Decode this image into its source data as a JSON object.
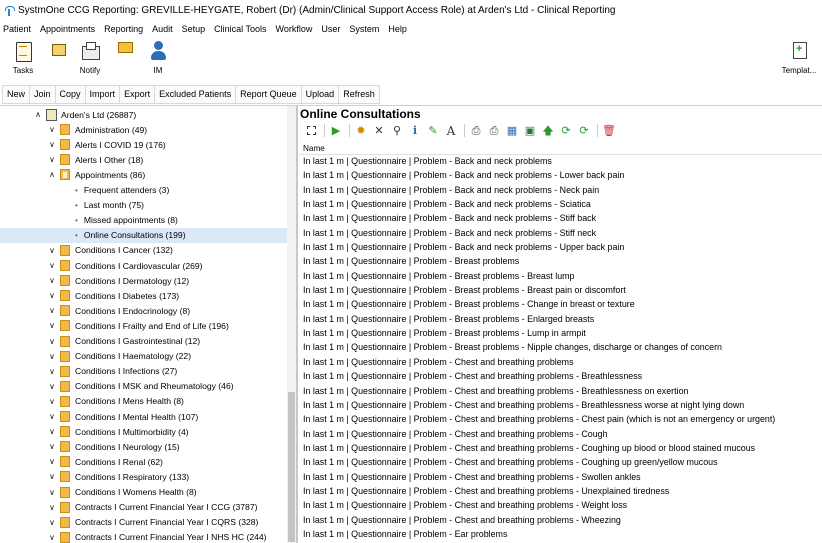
{
  "window": {
    "title": "SystmOne CCG Reporting: GREVILLE-HEYGATE, Robert (Dr) (Admin/Clinical Support Access Role) at Arden's Ltd - Clinical Reporting"
  },
  "menu": [
    "Patient",
    "Appointments",
    "Reporting",
    "Audit",
    "Setup",
    "Clinical Tools",
    "Workflow",
    "User",
    "System",
    "Help"
  ],
  "ribbon": {
    "tasks": "Tasks",
    "notify": "Notify",
    "im": "IM",
    "templates": "Templat..."
  },
  "toolbar": [
    "New",
    "Join",
    "Copy",
    "Import",
    "Export",
    "Excluded Patients",
    "Report Queue",
    "Upload",
    "Refresh"
  ],
  "tree": {
    "root": "Arden's Ltd (26887)",
    "items": [
      {
        "label": "Administration (49)",
        "kind": "folder"
      },
      {
        "label": "Alerts I COVID 19 (176)",
        "kind": "folder"
      },
      {
        "label": "Alerts I Other (18)",
        "kind": "folder"
      },
      {
        "label": "Appointments (86)",
        "kind": "folder-open"
      },
      {
        "label": "Frequent attenders (3)",
        "kind": "leaf"
      },
      {
        "label": "Last month (75)",
        "kind": "leaf"
      },
      {
        "label": "Missed appointments (8)",
        "kind": "leaf"
      },
      {
        "label": "Online Consultations (199)",
        "kind": "leaf-selected"
      },
      {
        "label": "Conditions I Cancer (132)",
        "kind": "folder"
      },
      {
        "label": "Conditions I Cardiovascular (269)",
        "kind": "folder"
      },
      {
        "label": "Conditions I Dermatology (12)",
        "kind": "folder"
      },
      {
        "label": "Conditions I Diabetes (173)",
        "kind": "folder"
      },
      {
        "label": "Conditions I Endocrinology (8)",
        "kind": "folder"
      },
      {
        "label": "Conditions I Frailty and End of Life (196)",
        "kind": "folder"
      },
      {
        "label": "Conditions I Gastrointestinal (12)",
        "kind": "folder"
      },
      {
        "label": "Conditions I Haematology (22)",
        "kind": "folder"
      },
      {
        "label": "Conditions I Infections (27)",
        "kind": "folder"
      },
      {
        "label": "Conditions I MSK and Rheumatology (46)",
        "kind": "folder"
      },
      {
        "label": "Conditions I Mens Health (8)",
        "kind": "folder"
      },
      {
        "label": "Conditions I Mental Health (107)",
        "kind": "folder"
      },
      {
        "label": "Conditions I Multimorbidity (4)",
        "kind": "folder"
      },
      {
        "label": "Conditions I Neurology (15)",
        "kind": "folder"
      },
      {
        "label": "Conditions I Renal (62)",
        "kind": "folder"
      },
      {
        "label": "Conditions I Respiratory (133)",
        "kind": "folder"
      },
      {
        "label": "Conditions I Womens Health (8)",
        "kind": "folder"
      },
      {
        "label": "Contracts I Current Financial Year I CCG (3787)",
        "kind": "folder"
      },
      {
        "label": "Contracts I Current Financial Year I CQRS (328)",
        "kind": "folder"
      },
      {
        "label": "Contracts I Current Financial Year I NHS HC (244)",
        "kind": "folder"
      }
    ]
  },
  "main": {
    "heading": "Online Consultations",
    "column_name": "Name",
    "rows": [
      "In last 1 m | Questionnaire | Problem - Back and neck problems",
      "In last 1 m | Questionnaire | Problem - Back and neck problems - Lower back pain",
      "In last 1 m | Questionnaire | Problem - Back and neck problems - Neck pain",
      "In last 1 m | Questionnaire | Problem - Back and neck problems - Sciatica",
      "In last 1 m | Questionnaire | Problem - Back and neck problems - Stiff back",
      "In last 1 m | Questionnaire | Problem - Back and neck problems - Stiff neck",
      "In last 1 m | Questionnaire | Problem - Back and neck problems - Upper back pain",
      "In last 1 m | Questionnaire | Problem - Breast problems",
      "In last 1 m | Questionnaire | Problem - Breast problems - Breast lump",
      "In last 1 m | Questionnaire | Problem - Breast problems - Breast pain or discomfort",
      "In last 1 m | Questionnaire | Problem - Breast problems - Change in breast or texture",
      "In last 1 m | Questionnaire | Problem - Breast problems - Enlarged breasts",
      "In last 1 m | Questionnaire | Problem - Breast problems - Lump in armpit",
      "In last 1 m | Questionnaire | Problem - Breast problems - Nipple changes, discharge or changes of concern",
      "In last 1 m | Questionnaire | Problem - Chest and breathing problems",
      "In last 1 m | Questionnaire | Problem - Chest and breathing problems - Breathlessness",
      "In last 1 m | Questionnaire | Problem - Chest and breathing problems - Breathlessness on exertion",
      "In last 1 m | Questionnaire | Problem - Chest and breathing problems - Breathlessness worse at night lying down",
      "In last 1 m | Questionnaire | Problem - Chest and breathing problems - Chest pain (which is not an emergency or urgent)",
      "In last 1 m | Questionnaire | Problem - Chest and breathing problems - Cough",
      "In last 1 m | Questionnaire | Problem - Chest and breathing problems - Coughing up blood or blood stained mucous",
      "In last 1 m | Questionnaire | Problem - Chest and breathing problems - Coughing up green/yellow mucous",
      "In last 1 m | Questionnaire | Problem - Chest and breathing problems - Swollen ankles",
      "In last 1 m | Questionnaire | Problem - Chest and breathing problems - Unexplained tiredness",
      "In last 1 m | Questionnaire | Problem - Chest and breathing problems - Weight loss",
      "In last 1 m | Questionnaire | Problem - Chest and breathing problems - Wheezing",
      "In last 1 m | Questionnaire | Problem - Ear problems"
    ]
  }
}
